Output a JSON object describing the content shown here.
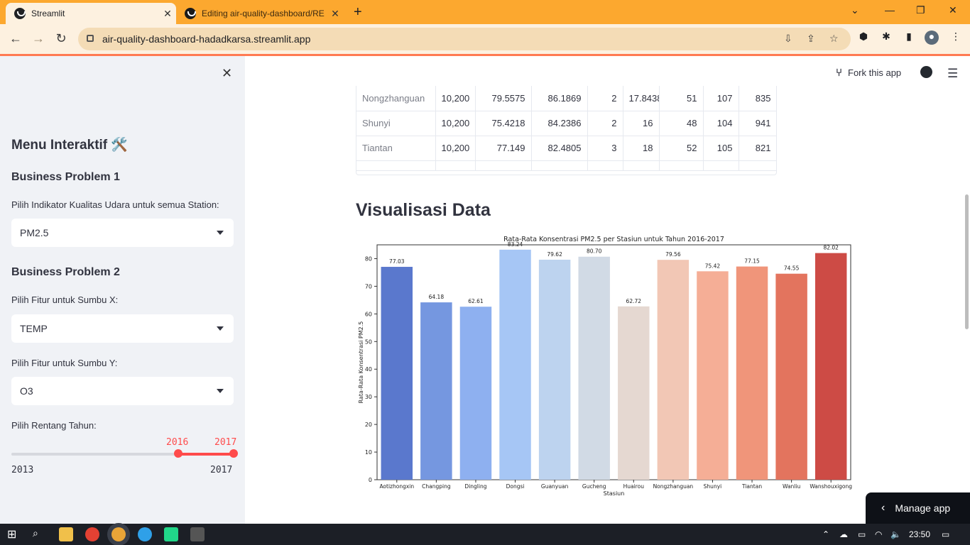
{
  "browser": {
    "tabs": [
      {
        "title": "Streamlit",
        "active": true
      },
      {
        "title": "Editing air-quality-dashboard/RE",
        "active": false
      }
    ],
    "url": "air-quality-dashboard-hadadkarsa.streamlit.app"
  },
  "sidebar": {
    "title": "Menu Interaktif 🛠️",
    "bp1": {
      "heading": "Business Problem 1",
      "label": "Pilih Indikator Kualitas Udara untuk semua Station:",
      "value": "PM2.5"
    },
    "bp2": {
      "heading": "Business Problem 2",
      "x_label": "Pilih Fitur untuk Sumbu X:",
      "x_value": "TEMP",
      "y_label": "Pilih Fitur untuk Sumbu Y:",
      "y_value": "O3"
    },
    "range": {
      "label": "Pilih Rentang Tahun:",
      "low": "2016",
      "high": "2017",
      "min": "2013",
      "max": "2017"
    }
  },
  "header": {
    "fork": "Fork this app"
  },
  "table": {
    "rows": [
      [
        "Nongzhanguan",
        "10,200",
        "79.5575",
        "86.1869",
        "2",
        "17.8438",
        "51",
        "107",
        "835"
      ],
      [
        "Shunyi",
        "10,200",
        "75.4218",
        "84.2386",
        "2",
        "16",
        "48",
        "104",
        "941"
      ],
      [
        "Tiantan",
        "10,200",
        "77.149",
        "82.4805",
        "3",
        "18",
        "52",
        "105",
        "821"
      ]
    ]
  },
  "section_title": "Visualisasi Data",
  "chart_data": {
    "type": "bar",
    "title": "Rata-Rata Konsentrasi PM2.5 per Stasiun untuk Tahun 2016-2017",
    "xlabel": "Stasiun",
    "ylabel": "Rata-Rata Konsentrasi PM2.5",
    "ylim": [
      0,
      85
    ],
    "yticks": [
      0,
      10,
      20,
      30,
      40,
      50,
      60,
      70,
      80
    ],
    "categories": [
      "Aotizhongxin",
      "Changping",
      "Dingling",
      "Dongsi",
      "Guanyuan",
      "Gucheng",
      "Huairou",
      "Nongzhanguan",
      "Shunyi",
      "Tiantan",
      "Wanliu",
      "Wanshouxigong"
    ],
    "values": [
      77.03,
      64.18,
      62.61,
      83.24,
      79.62,
      80.7,
      62.72,
      79.56,
      75.42,
      77.15,
      74.55,
      82.02
    ],
    "value_labels": [
      "77.03",
      "64.18",
      "62.61",
      "83.24",
      "79.62",
      "80.70",
      "62.72",
      "79.56",
      "75.42",
      "77.15",
      "74.55",
      "82.02"
    ],
    "colors": [
      "#5a78cd",
      "#7597e0",
      "#8eb0f0",
      "#a6c6f5",
      "#bdd3ef",
      "#d1dae5",
      "#e5d8d1",
      "#f2c7b5",
      "#f5ae96",
      "#f0957a",
      "#e3745e",
      "#cd4b45"
    ],
    "grid": false
  },
  "manage_app": "Manage app",
  "taskbar": {
    "time": "23:50"
  }
}
